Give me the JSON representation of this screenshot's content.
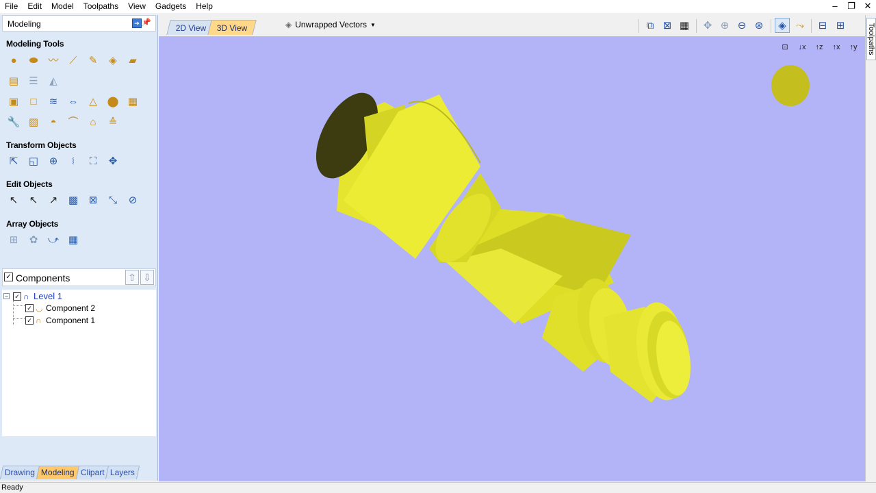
{
  "menubar": {
    "items": [
      "File",
      "Edit",
      "Model",
      "Toolpaths",
      "View",
      "Gadgets",
      "Help"
    ]
  },
  "window_controls": {
    "minimize": "–",
    "restore": "❐",
    "close": "✕"
  },
  "left_panel": {
    "title": "Modeling",
    "sections": {
      "modeling_tools": "Modeling Tools",
      "transform_objects": "Transform Objects",
      "edit_objects": "Edit Objects",
      "array_objects": "Array Objects"
    }
  },
  "components": {
    "title": "Components",
    "tree": {
      "level": "Level 1",
      "children": [
        "Component 2",
        "Component 1"
      ]
    }
  },
  "bottom_tabs": [
    "Drawing",
    "Modeling",
    "Clipart",
    "Layers"
  ],
  "active_bottom_tab": "Modeling",
  "view_tabs": [
    "2D View",
    "3D View"
  ],
  "active_view_tab": "3D View",
  "vector_dropdown": "Unwrapped Vectors",
  "right_strip_label": "Toolpaths",
  "status": "Ready",
  "colors": {
    "viewport_bg": "#b3b3f7",
    "model_yellow": "#e9e92a",
    "light_sphere": "#c4bf1f",
    "panel_bg": "#dde9f7",
    "active_tab": "#ffc96b"
  }
}
